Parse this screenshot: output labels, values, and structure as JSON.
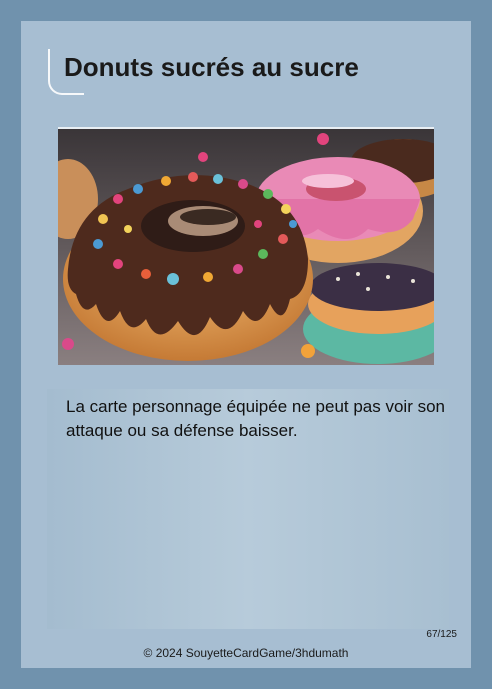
{
  "card": {
    "title": "Donuts sucrés au sucre",
    "description": "La carte personnage équipée ne peut pas voir son attaque ou sa défense baisser.",
    "number": "67/125",
    "copyright": "© 2024 SouyetteCardGame/3hdumath"
  },
  "colors": {
    "frame": "#7092ad",
    "card": "#a7bed2",
    "text": "#1a1a1a"
  }
}
